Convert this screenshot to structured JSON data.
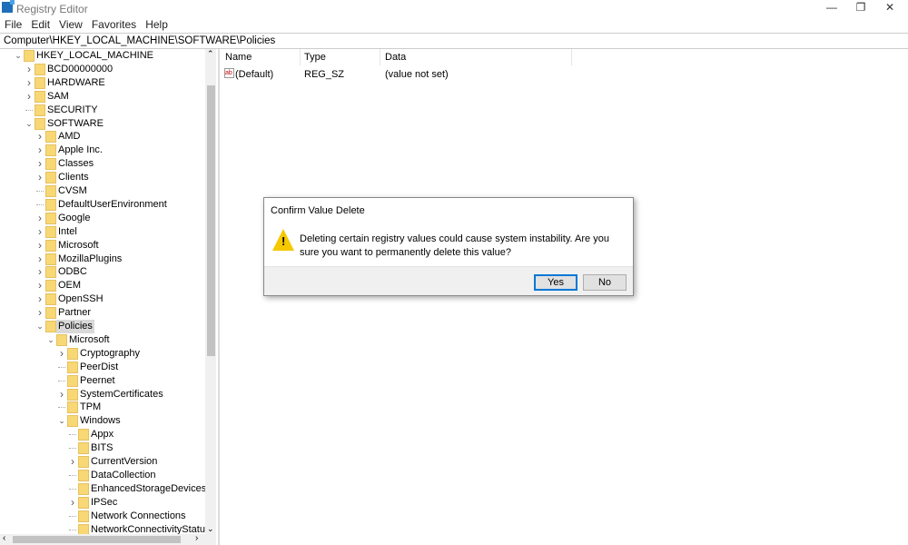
{
  "window": {
    "title": "Registry Editor",
    "minimize": "—",
    "restore": "❐",
    "close": "✕"
  },
  "menu": [
    "File",
    "Edit",
    "View",
    "Favorites",
    "Help"
  ],
  "address": "Computer\\HKEY_LOCAL_MACHINE\\SOFTWARE\\Policies",
  "tree": [
    {
      "label": "HKEY_LOCAL_MACHINE",
      "level": 0,
      "exp": "open"
    },
    {
      "label": "BCD00000000",
      "level": 1,
      "exp": "closed"
    },
    {
      "label": "HARDWARE",
      "level": 1,
      "exp": "closed"
    },
    {
      "label": "SAM",
      "level": 1,
      "exp": "closed"
    },
    {
      "label": "SECURITY",
      "level": 1,
      "exp": "none"
    },
    {
      "label": "SOFTWARE",
      "level": 1,
      "exp": "open"
    },
    {
      "label": "AMD",
      "level": 2,
      "exp": "closed"
    },
    {
      "label": "Apple Inc.",
      "level": 2,
      "exp": "closed"
    },
    {
      "label": "Classes",
      "level": 2,
      "exp": "closed"
    },
    {
      "label": "Clients",
      "level": 2,
      "exp": "closed"
    },
    {
      "label": "CVSM",
      "level": 2,
      "exp": "none"
    },
    {
      "label": "DefaultUserEnvironment",
      "level": 2,
      "exp": "none"
    },
    {
      "label": "Google",
      "level": 2,
      "exp": "closed"
    },
    {
      "label": "Intel",
      "level": 2,
      "exp": "closed"
    },
    {
      "label": "Microsoft",
      "level": 2,
      "exp": "closed"
    },
    {
      "label": "MozillaPlugins",
      "level": 2,
      "exp": "closed"
    },
    {
      "label": "ODBC",
      "level": 2,
      "exp": "closed"
    },
    {
      "label": "OEM",
      "level": 2,
      "exp": "closed"
    },
    {
      "label": "OpenSSH",
      "level": 2,
      "exp": "closed"
    },
    {
      "label": "Partner",
      "level": 2,
      "exp": "closed"
    },
    {
      "label": "Policies",
      "level": 2,
      "exp": "open",
      "selected": true
    },
    {
      "label": "Microsoft",
      "level": 3,
      "exp": "open"
    },
    {
      "label": "Cryptography",
      "level": 4,
      "exp": "closed"
    },
    {
      "label": "PeerDist",
      "level": 4,
      "exp": "none"
    },
    {
      "label": "Peernet",
      "level": 4,
      "exp": "none"
    },
    {
      "label": "SystemCertificates",
      "level": 4,
      "exp": "closed"
    },
    {
      "label": "TPM",
      "level": 4,
      "exp": "none"
    },
    {
      "label": "Windows",
      "level": 4,
      "exp": "open"
    },
    {
      "label": "Appx",
      "level": 5,
      "exp": "none"
    },
    {
      "label": "BITS",
      "level": 5,
      "exp": "none"
    },
    {
      "label": "CurrentVersion",
      "level": 5,
      "exp": "closed"
    },
    {
      "label": "DataCollection",
      "level": 5,
      "exp": "none"
    },
    {
      "label": "EnhancedStorageDevices",
      "level": 5,
      "exp": "none"
    },
    {
      "label": "IPSec",
      "level": 5,
      "exp": "closed"
    },
    {
      "label": "Network Connections",
      "level": 5,
      "exp": "none"
    },
    {
      "label": "NetworkConnectivityStatusIndic",
      "level": 5,
      "exp": "none"
    }
  ],
  "values": {
    "columns": [
      "Name",
      "Type",
      "Data"
    ],
    "rows": [
      {
        "name": "(Default)",
        "type": "REG_SZ",
        "data": "(value not set)",
        "icon": "string-value-icon"
      }
    ]
  },
  "dialog": {
    "title": "Confirm Value Delete",
    "message": "Deleting certain registry values could cause system instability. Are you sure you want to permanently delete this value?",
    "yes": "Yes",
    "no": "No",
    "icon": "warning-icon"
  }
}
